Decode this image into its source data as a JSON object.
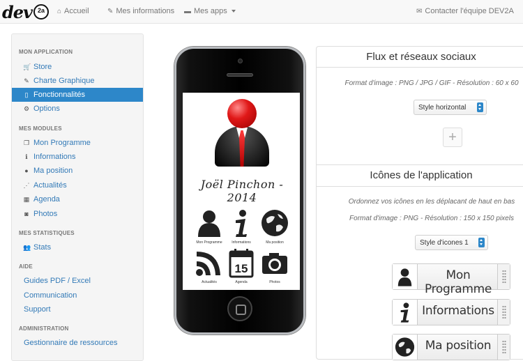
{
  "brand": {
    "name": "dev",
    "badge": "2a"
  },
  "nav": {
    "home": "Accueil",
    "my_info": "Mes informations",
    "my_apps": "Mes apps",
    "contact": "Contacter l'équipe DEV2A"
  },
  "sidebar": {
    "sections": [
      {
        "title": "MON APPLICATION",
        "items": [
          {
            "label": "Store",
            "icon": "cart-icon"
          },
          {
            "label": "Charte Graphique",
            "icon": "pencil-icon"
          },
          {
            "label": "Fonctionnalités",
            "icon": "list-icon",
            "active": true
          },
          {
            "label": "Options",
            "icon": "gears-icon"
          }
        ]
      },
      {
        "title": "MES MODULES",
        "items": [
          {
            "label": "Mon Programme",
            "icon": "book-icon"
          },
          {
            "label": "Informations",
            "icon": "info-icon"
          },
          {
            "label": "Ma position",
            "icon": "globe-icon"
          },
          {
            "label": "Actualités",
            "icon": "rss-icon"
          },
          {
            "label": "Agenda",
            "icon": "calendar-icon"
          },
          {
            "label": "Photos",
            "icon": "camera-icon"
          }
        ]
      },
      {
        "title": "MES STATISTIQUES",
        "items": [
          {
            "label": "Stats",
            "icon": "users-icon"
          }
        ]
      },
      {
        "title": "AIDE",
        "items": [
          {
            "label": "Guides PDF / Excel"
          },
          {
            "label": "Communication"
          },
          {
            "label": "Support"
          }
        ]
      },
      {
        "title": "ADMINISTRATION",
        "items": [
          {
            "label": "Gestionnaire de ressources"
          }
        ]
      }
    ]
  },
  "phone": {
    "signature": "Joël Pinchon - 2014",
    "apps": [
      {
        "label": "Mon Programme",
        "icon": "person-icon"
      },
      {
        "label": "Informations",
        "icon": "info-icon"
      },
      {
        "label": "Ma position",
        "icon": "globe-icon"
      },
      {
        "label": "Actualités",
        "icon": "rss-icon"
      },
      {
        "label": "Agenda",
        "icon": "calendar-icon",
        "day": "15"
      },
      {
        "label": "Photos",
        "icon": "camera-icon"
      }
    ]
  },
  "panel": {
    "social_title": "Flux et réseaux sociaux",
    "social_note": "Format d'image : PNG / JPG / GIF - Résolution : 60 x 60",
    "social_style": "Style horizontal",
    "add_label": "+",
    "icons_title": "Icônes de l'application",
    "icons_note1": "Ordonnez vos icônes en les déplacant de haut en bas",
    "icons_note2": "Format d'image : PNG - Résolution : 150 x 150 pixels",
    "icons_style": "Style d'icones 1",
    "icon_rows": [
      {
        "label": "Mon Programme",
        "icon": "person-icon"
      },
      {
        "label": "Informations",
        "icon": "info-icon"
      },
      {
        "label": "Ma position",
        "icon": "globe-icon"
      }
    ]
  },
  "colors": {
    "accent": "#2d87c9",
    "link": "#337ab7"
  }
}
